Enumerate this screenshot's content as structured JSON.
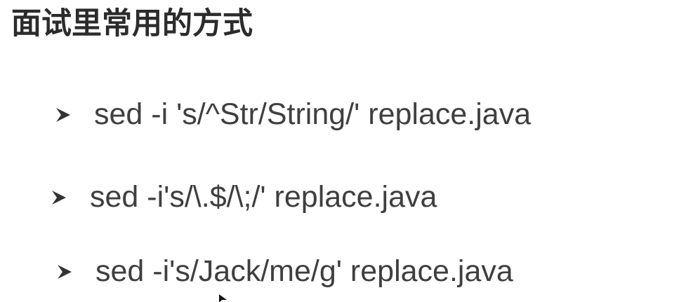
{
  "slide": {
    "title": "面试里常用的方式",
    "bullets": [
      {
        "icon": "arrowhead-bullet-icon",
        "text": "sed -i 's/^Str/String/' replace.java"
      },
      {
        "icon": "arrowhead-bullet-icon",
        "text": "sed -i's/\\.$/\\;/' replace.java"
      },
      {
        "icon": "arrowhead-bullet-icon",
        "text": "sed -i's/Jack/me/g' replace.java"
      }
    ]
  },
  "colors": {
    "background": "#ffffff",
    "title_text": "#2b2b2b",
    "body_text": "#3f3f3f",
    "bullet_icon": "#333333"
  }
}
